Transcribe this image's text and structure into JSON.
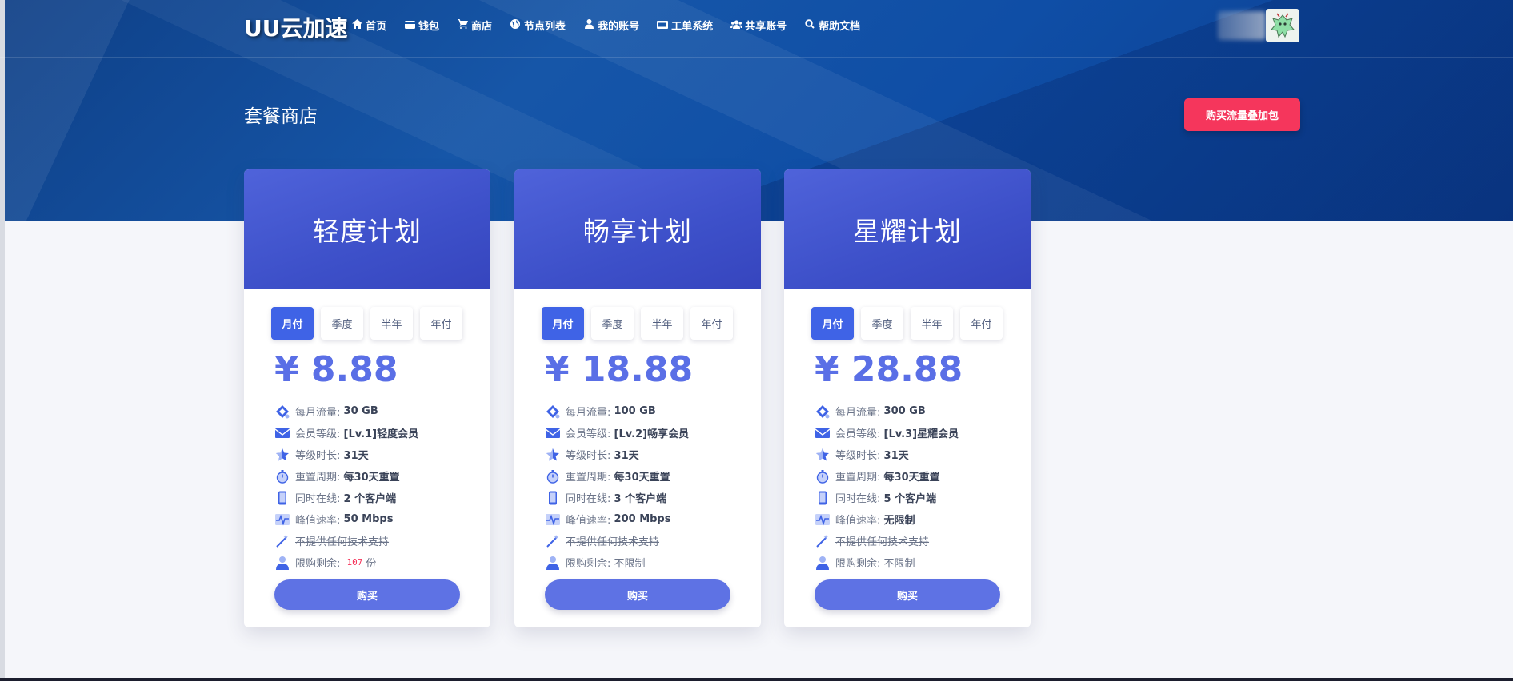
{
  "brand": "UU云加速",
  "nav": [
    {
      "label": "首页",
      "icon": "home-icon"
    },
    {
      "label": "钱包",
      "icon": "wallet-icon"
    },
    {
      "label": "商店",
      "icon": "cart-icon"
    },
    {
      "label": "节点列表",
      "icon": "globe-icon"
    },
    {
      "label": "我的账号",
      "icon": "user-icon"
    },
    {
      "label": "工单系统",
      "icon": "ticket-icon"
    },
    {
      "label": "共享账号",
      "icon": "users-icon"
    },
    {
      "label": "帮助文档",
      "icon": "search-icon"
    }
  ],
  "page_title": "套餐商店",
  "topup_button": "购买流量叠加包",
  "period_options": [
    "月付",
    "季度",
    "半年",
    "年付"
  ],
  "feature_labels": {
    "traffic": "每月流量:",
    "level": "会员等级:",
    "duration": "等级时长:",
    "reset": "重置周期:",
    "online": "同时在线:",
    "speed": "峰值速率:",
    "support": "不提供任何技术支持",
    "quota": "限购剩余:"
  },
  "plans": [
    {
      "title": "轻度计划",
      "price": "¥ 8.88",
      "traffic": "30 GB",
      "level": "[Lv.1]轻度会员",
      "duration": "31天",
      "reset": "每30天重置",
      "online": "2 个客户端",
      "speed": "50 Mbps",
      "quota_count": "107",
      "quota_unit": "份",
      "quota_text": "",
      "buy": "购买"
    },
    {
      "title": "畅享计划",
      "price": "¥ 18.88",
      "traffic": "100 GB",
      "level": "[Lv.2]畅享会员",
      "duration": "31天",
      "reset": "每30天重置",
      "online": "3 个客户端",
      "speed": "200 Mbps",
      "quota_count": "",
      "quota_unit": "",
      "quota_text": "不限制",
      "buy": "购买"
    },
    {
      "title": "星耀计划",
      "price": "¥ 28.88",
      "traffic": "300 GB",
      "level": "[Lv.3]星耀会员",
      "duration": "31天",
      "reset": "每30天重置",
      "online": "5 个客户端",
      "speed": "无限制",
      "quota_count": "",
      "quota_unit": "",
      "quota_text": "不限制",
      "buy": "购买"
    }
  ],
  "colors": {
    "accent": "#5e72e4",
    "active_tab": "#3f63e6",
    "danger": "#f5365c",
    "hero": "#1656a8"
  }
}
